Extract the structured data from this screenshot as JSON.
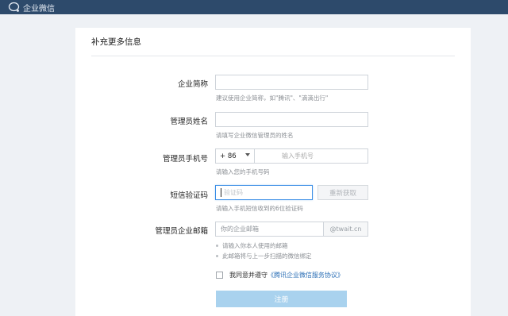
{
  "app": {
    "brand": "企业微信",
    "brand_icon": "chat-bubble-icon"
  },
  "form": {
    "title": "补充更多信息",
    "company_short_name": {
      "label": "企业简称",
      "value": "",
      "help": "建议使用企业简称，如\"腾讯\"、\"滴滴出行\""
    },
    "admin_name": {
      "label": "管理员姓名",
      "value": "",
      "help": "请填写企业微信管理员的姓名"
    },
    "admin_phone": {
      "label": "管理员手机号",
      "country_code": "+ 86",
      "placeholder": "输入手机号",
      "help": "请输入您的手机号码"
    },
    "sms_code": {
      "label": "短信验证码",
      "placeholder": "验证码",
      "resend_button": "重新获取",
      "help": "请输入手机短信收到的6位验证码"
    },
    "admin_email": {
      "label": "管理员企业邮箱",
      "placeholder": "你的企业邮箱",
      "domain_suffix": "@twait.cn",
      "notes": [
        "请输入你本人使用的邮箱",
        "此邮箱将与上一步扫描的微信绑定"
      ]
    },
    "agreement": {
      "prefix": "我同意并遵守",
      "link": "《腾讯企业微信服务协议》",
      "checked": false
    },
    "submit_label": "注册"
  },
  "colors": {
    "topbar": "#2d4a6b",
    "link": "#2b6fb6",
    "submit_disabled": "#a9d2ee",
    "focus_border": "#3a8ee6"
  }
}
